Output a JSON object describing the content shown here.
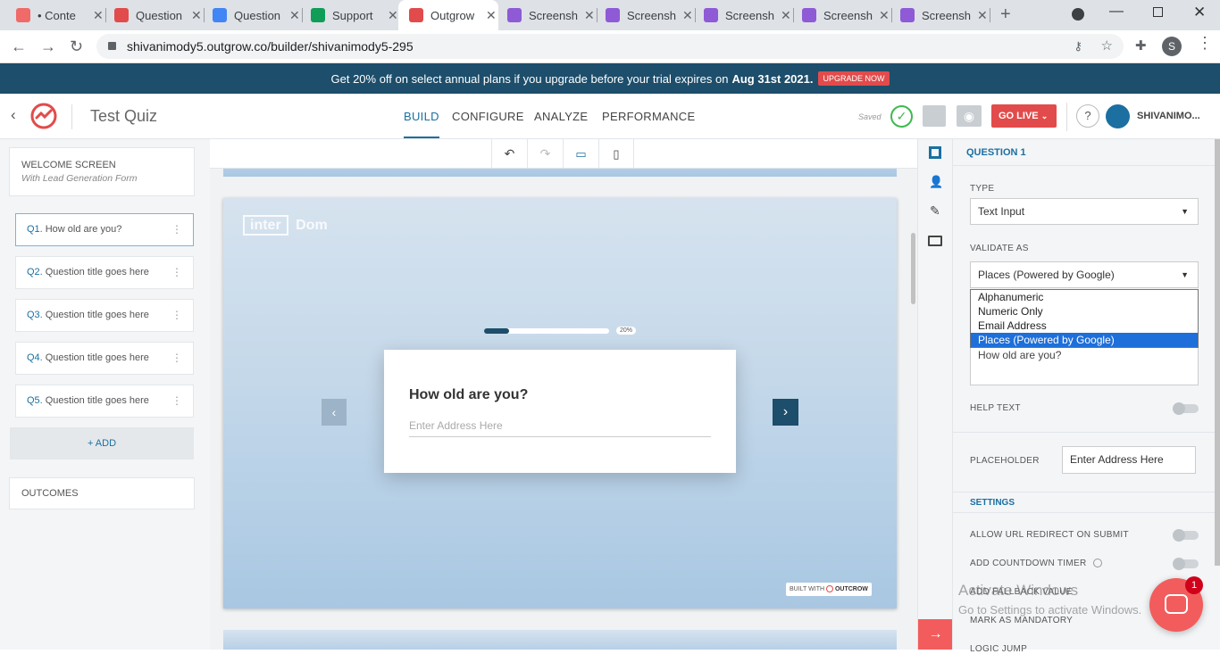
{
  "browser": {
    "tabs": [
      {
        "title": "• Conte",
        "icon": "asana-icon",
        "color": "#f06a6a"
      },
      {
        "title": "Question",
        "icon": "outgrow-icon",
        "color": "#e24b4b"
      },
      {
        "title": "Question",
        "icon": "docs-icon",
        "color": "#4285f4"
      },
      {
        "title": "Support",
        "icon": "sheets-icon",
        "color": "#0f9d58"
      },
      {
        "title": "Outgrow",
        "icon": "outgrow-icon",
        "color": "#e24b4b"
      },
      {
        "title": "Screensh",
        "icon": "feather-icon",
        "color": "#8e5ad6"
      },
      {
        "title": "Screensh",
        "icon": "feather-icon",
        "color": "#8e5ad6"
      },
      {
        "title": "Screensh",
        "icon": "feather-icon",
        "color": "#8e5ad6"
      },
      {
        "title": "Screensh",
        "icon": "feather-icon",
        "color": "#8e5ad6"
      },
      {
        "title": "Screensh",
        "icon": "feather-icon",
        "color": "#8e5ad6"
      }
    ],
    "url": "shivanimody5.outgrow.co/builder/shivanimody5-295",
    "profile_initial": "S"
  },
  "banner": {
    "text": "Get 20% off on select annual plans if you upgrade before your trial expires on",
    "date": "Aug 31st 2021.",
    "cta": "UPGRADE NOW"
  },
  "header": {
    "title": "Test Quiz",
    "tabs": [
      "BUILD",
      "CONFIGURE",
      "ANALYZE",
      "PERFORMANCE"
    ],
    "saved": "Saved",
    "go_live": "GO LIVE",
    "help": "?",
    "user": "SHIVANIMO..."
  },
  "sidebar": {
    "welcome_title": "WELCOME SCREEN",
    "welcome_sub": "With Lead Generation Form",
    "questions": [
      {
        "num": "Q1.",
        "text": "How old are you?"
      },
      {
        "num": "Q2.",
        "text": "Question title goes here"
      },
      {
        "num": "Q3.",
        "text": "Question title goes here"
      },
      {
        "num": "Q4.",
        "text": "Question title goes here"
      },
      {
        "num": "Q5.",
        "text": "Question title goes here"
      }
    ],
    "add": "+ ADD",
    "outcomes": "OUTCOMES"
  },
  "preview": {
    "logo_a": "inter",
    "logo_b": "Dom",
    "progress_label": "20%",
    "progress": 0.2,
    "question": "How old are you?",
    "placeholder": "Enter Address Here",
    "built_with": "BUILT WITH",
    "brand": "OUTCROW"
  },
  "panel": {
    "section": "QUESTION 1",
    "type_label": "TYPE",
    "type_value": "Text Input",
    "validate_label": "VALIDATE AS",
    "validate_value": "Places (Powered by Google)",
    "validate_options": [
      "Alphanumeric",
      "Numeric Only",
      "Email Address",
      "Places (Powered by Google)"
    ],
    "question_text": "How old are you?",
    "help_text": "HELP TEXT",
    "placeholder_label": "PLACEHOLDER",
    "placeholder_value": "Enter Address Here",
    "settings": "SETTINGS",
    "allow_redirect": "ALLOW URL REDIRECT ON SUBMIT",
    "countdown": "ADD COUNTDOWN TIMER",
    "fallback": "ADD FALLBACK VALUE",
    "mandatory": "MARK AS MANDATORY",
    "logic": "LOGIC JUMP"
  },
  "overlay": {
    "activate_title": "Activate Windows",
    "activate_sub": "Go to Settings to activate Windows.",
    "chat_badge": "1"
  },
  "colors": {
    "accent": "#1b6fa1",
    "banner": "#1d4e6b",
    "danger": "#e24b4b",
    "nav_arrow": "#1d4e6b"
  }
}
